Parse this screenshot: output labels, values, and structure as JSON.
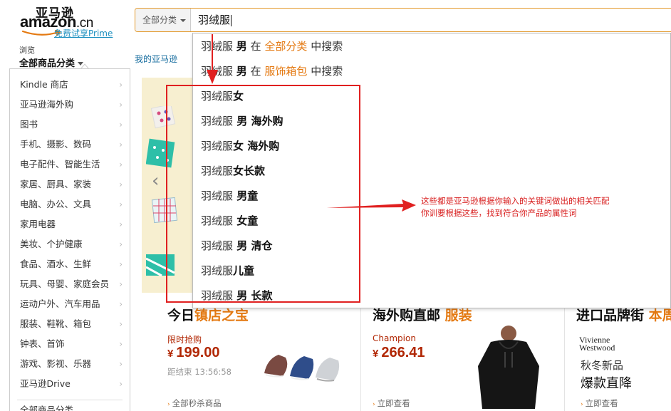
{
  "header": {
    "logo": {
      "cn": "亚马逊",
      "en": "amazon",
      "suffix": ".cn",
      "prime_link": "免费试享Prime"
    },
    "search": {
      "category": "全部分类",
      "query": "羽绒服"
    },
    "browse": {
      "small": "浏览",
      "big": "全部商品分类"
    },
    "my_amazon": "我的亚马逊"
  },
  "sidebar": {
    "items": [
      {
        "label": "Kindle 商店"
      },
      {
        "label": "亚马逊海外购"
      },
      {
        "label": "图书"
      },
      {
        "label": "手机、摄影、数码"
      },
      {
        "label": "电子配件、智能生活"
      },
      {
        "label": "家居、厨具、家装"
      },
      {
        "label": "电脑、办公、文具"
      },
      {
        "label": "家用电器"
      },
      {
        "label": "美妆、个护健康"
      },
      {
        "label": "食品、酒水、生鲜"
      },
      {
        "label": "玩具、母婴、家庭会员"
      },
      {
        "label": "运动户外、汽车用品"
      },
      {
        "label": "服装、鞋靴、箱包"
      },
      {
        "label": "钟表、首饰"
      },
      {
        "label": "游戏、影视、乐器"
      },
      {
        "label": "亚马逊Drive"
      }
    ],
    "all_categories": "全部商品分类"
  },
  "suggestions": {
    "scoped": [
      {
        "query": "羽绒服",
        "term": "男",
        "in": "在",
        "category": "全部分类",
        "action": "中搜索"
      },
      {
        "query": "羽绒服",
        "term": "男",
        "in": "在",
        "category": "服饰箱包",
        "action": "中搜索"
      }
    ],
    "items": [
      {
        "base": "羽绒服",
        "extra": "女"
      },
      {
        "base": "羽绒服",
        "extra": " 男 海外购"
      },
      {
        "base": "羽绒服",
        "extra": "女 海外购"
      },
      {
        "base": "羽绒服",
        "extra": "女长款"
      },
      {
        "base": "羽绒服",
        "extra": " 男童"
      },
      {
        "base": "羽绒服",
        "extra": " 女童"
      },
      {
        "base": "羽绒服",
        "extra": " 男 清仓"
      },
      {
        "base": "羽绒服",
        "extra": "儿童"
      },
      {
        "base": "羽绒服",
        "extra": " 男 长款"
      }
    ]
  },
  "cards": {
    "deals": {
      "title_prefix": "今日",
      "title_highlight": "镇店之宝",
      "subtitle": "限时抢购",
      "price": "199.00",
      "currency": "¥",
      "countdown_label": "距结束",
      "countdown": "13:56:58",
      "link": "全部秒杀商品"
    },
    "overseas": {
      "title_prefix": "海外购直邮",
      "title_highlight": "服装",
      "brand": "Champion",
      "price": "266.41",
      "currency": "¥",
      "link": "立即查看"
    },
    "import": {
      "title_prefix": "进口品牌街",
      "title_highlight": "本周",
      "brand_line1": "Vivienne",
      "brand_line2": "Westwood",
      "line1": "秋冬新品",
      "line2": "爆款直降",
      "link": "立即查看"
    }
  },
  "annotation": {
    "line1": "这些都是亚马逊根据你输入的关键词做出的相关匹配",
    "line2": "你训要根据这些，找到符合你产品的属性词"
  },
  "colors": {
    "accent_orange": "#e47911",
    "price_red": "#b12704",
    "annotation_red": "#e02020",
    "link_blue": "#1a6fa0"
  }
}
